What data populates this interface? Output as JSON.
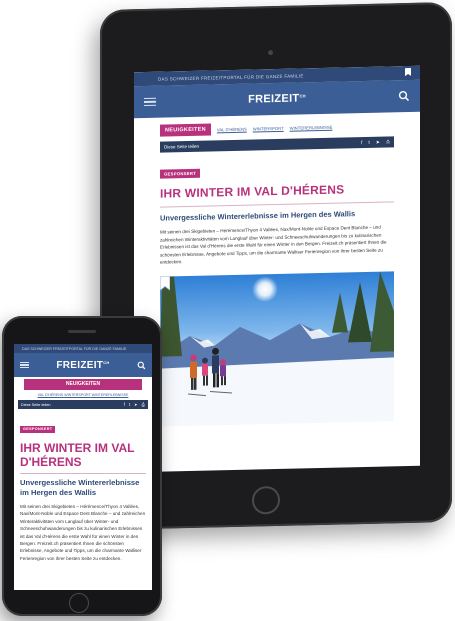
{
  "site": {
    "top_strip": "DAS SCHWEIZER FREIZEITPORTAL FÜR DIE GANZE FAMILIE",
    "logo": "FREIZEIT",
    "logo_suffix": "CH",
    "active_tab": "NEUIGKEITEN",
    "tab_links": [
      "VAL D'HÉRENS",
      "WINTERSPORT",
      "WINTERERLEBNISSE"
    ],
    "share_label": "Diese Seite teilen",
    "share_icons": [
      "f",
      "t",
      "➤",
      "⎙"
    ]
  },
  "article": {
    "sponsor_tag": "GESPONSERT",
    "headline": "IHR WINTER IM VAL D'HÉRENS",
    "phone_headline": "IHR WINTER IM VAL D'HÉRENS",
    "subhead": "Unvergessliche Wintererlebnisse im Hergen des Wallis",
    "body_tablet": "Mit seinen drei Skigebieten – Hérémence/Thyon 4 Vallées, Nax/Mont-Noble und Espace Dent Blanche – und zahlreichen Winteraktivitäten vom Langlauf über Winter- und Schneeschuhwanderungen bis zu kulinarischen Erlebnissen ist das Val d'Hérens die erste Wahl für einen Winter in den Bergen. Freizeit.ch präsentiert Ihnen die schönsten Erlebnisse, Angebote und Tipps, um die charmante Walliser Ferienregion von ihrer besten Seite zu entdecken.",
    "body_phone": "Mit seinen drei Skigebieten – Hérémence/Thyon 4 Vallées, Nax/Mont-Noble und Espace Dent Blanche – und zahlreichen Winteraktivitäten vom Langlauf über Winter- und Schneeschuhwanderungen bis zu kulinarischen Erlebnissen ist das Val d'Hérens die erste Wahl für einen Winter in den Bergen. Freizeit.ch präsentiert Ihnen die schönsten Erlebnisse, Angebote und Tipps, um die charmante Walliser Ferienregion von ihrer besten Seite zu entdecken."
  },
  "colors": {
    "brand_blue": "#3c5e96",
    "dark_blue": "#2f4a78",
    "accent_magenta": "#b8317c"
  },
  "icons": [
    "hamburger-menu-icon",
    "search-icon",
    "bookmark-icon",
    "facebook-icon",
    "twitter-icon",
    "send-icon",
    "print-icon"
  ]
}
